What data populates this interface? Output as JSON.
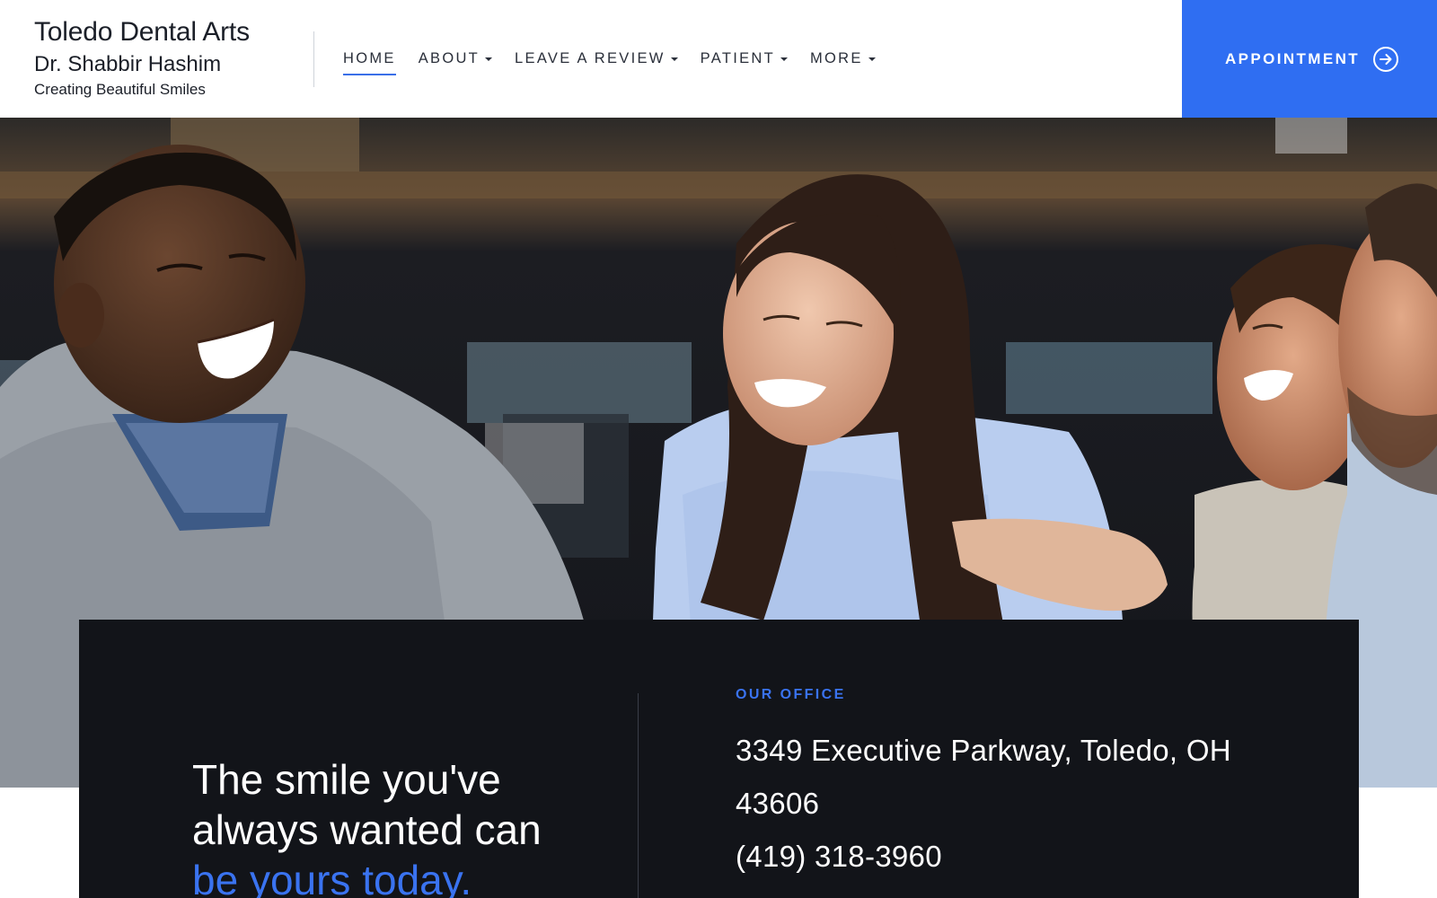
{
  "header": {
    "brand": {
      "title": "Toledo Dental Arts",
      "doctor": "Dr. Shabbir Hashim",
      "tagline": "Creating Beautiful Smiles"
    },
    "nav": {
      "items": [
        {
          "label": "HOME",
          "active": true,
          "has_dropdown": false
        },
        {
          "label": "ABOUT",
          "active": false,
          "has_dropdown": true
        },
        {
          "label": "LEAVE A REVIEW",
          "active": false,
          "has_dropdown": true
        },
        {
          "label": "PATIENT",
          "active": false,
          "has_dropdown": true
        },
        {
          "label": "MORE",
          "active": false,
          "has_dropdown": true
        }
      ]
    },
    "appointment": {
      "label": "APPOINTMENT",
      "icon": "arrow-right-circle-icon"
    }
  },
  "hero": {
    "photo": "four-friends-laughing-photo"
  },
  "panel": {
    "headline_line1": "The smile you've",
    "headline_line2": "always wanted can",
    "headline_accent": "be yours today.",
    "office": {
      "heading": "OUR OFFICE",
      "address": "3349 Executive Parkway, Toledo, OH 43606",
      "phone": "(419) 318-3960"
    }
  },
  "colors": {
    "accent": "#2f6ef2",
    "panel_bg": "#121419",
    "text_dark": "#1b1f28"
  }
}
